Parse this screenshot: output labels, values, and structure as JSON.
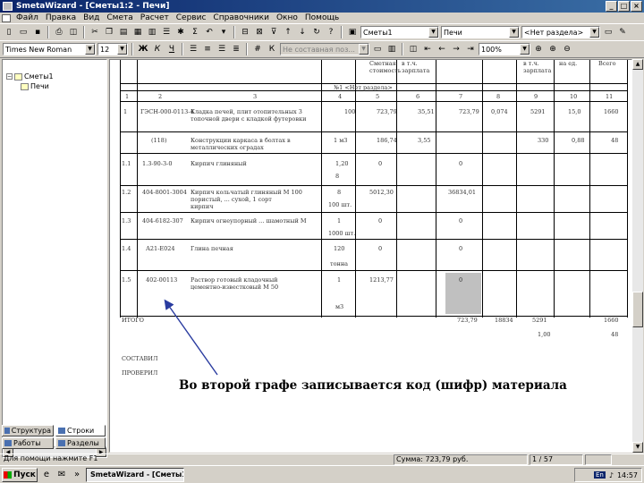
{
  "window": {
    "title": "SmetaWizard - [Сметы1:2 - Печи]"
  },
  "menu": [
    "Файл",
    "Правка",
    "Вид",
    "Смета",
    "Расчет",
    "Сервис",
    "Справочники",
    "Окно",
    "Помощь"
  ],
  "toolbar1": {
    "estimate_combo": "Сметы1",
    "section_combo": "Печи",
    "no_section_combo": "<Нет раздела>"
  },
  "toolbar2": {
    "font_combo": "Times New Roman",
    "size_combo": "12",
    "bold": "Ж",
    "italic": "К",
    "underline": "Ч",
    "disabled_combo": "Не составная поз...",
    "zoom_combo": "100%"
  },
  "tree": {
    "root": "Сметы1",
    "child": "Печи"
  },
  "left_tabs": {
    "structure": "Структура",
    "rows": "Строки",
    "works": "Работы",
    "sections": "Разделы"
  },
  "doc": {
    "col_headers_top": [
      "Сметная",
      "в т.ч.",
      "в т.ч.",
      "на ед.",
      "Всего"
    ],
    "col_headers_top2": [
      "стоимость",
      "зарплата",
      "зарплата"
    ],
    "section_label": "№1 <Нет раздела>",
    "col_numbers": [
      "1",
      "2",
      "3",
      "4",
      "5",
      "6",
      "7",
      "8",
      "9",
      "10",
      "11"
    ],
    "rows": [
      {
        "num": "1",
        "code": "ГЭСН-000-0113-4",
        "name1": "Кладка печей, плит отопительных 3",
        "name2": "топочной двери с кладкой футеровки",
        "unit": "100",
        "c5": "723,79",
        "c6": "35,51",
        "c7": "723,79",
        "c8": "0,074",
        "c9": "5291",
        "c10": "15,0",
        "c11": "1660"
      },
      {
        "num": "",
        "code": "(118)",
        "name1": "Конструкции каркаса в болтах в",
        "name2": "металлических оградах",
        "unit": "1 м3",
        "c5": "186,74",
        "c6": "3,55",
        "c7": "",
        "c8": "",
        "c9": "330",
        "c10": "0,88",
        "c11": "48"
      },
      {
        "num": "1.1",
        "code": "1.3-90-3-0",
        "name1": "Кирпич глиняный",
        "name2": "",
        "unit": "1,20",
        "c5": "0",
        "c6": "",
        "c7": "0",
        "c8": "",
        "c9": "",
        "c10": "",
        "c11": ""
      },
      {
        "num": "1.2",
        "code": "404-8001-3004",
        "name1": "Кирпич кольчатый глиняный М 100",
        "name2": "пористый, ... сухой, 1 сорт",
        "unit": "8",
        "c5": "5012,30",
        "c6": "",
        "c7": "36834,01",
        "c8": "",
        "c9": "",
        "c10": "",
        "c11": ""
      },
      {
        "num": "1.3",
        "code": "404-6182-307",
        "name1": "Кирпич огнеупорный ... шамотный М",
        "name2": "",
        "unit": "1",
        "c5": "0",
        "c6": "",
        "c7": "0",
        "c8": "",
        "c9": "",
        "c10": "",
        "c11": ""
      },
      {
        "num": "1.4",
        "code": "А21-Е024",
        "name1": "Глина печная",
        "name2": "",
        "unit": "120",
        "c5": "0",
        "c6": "",
        "c7": "0",
        "c8": "",
        "c9": "",
        "c10": "",
        "c11": ""
      },
      {
        "num": "1.5",
        "code": "402-00113",
        "name1": "Раствор готовый кладочный",
        "name2": "цементно-известковый М 50",
        "unit": "1",
        "c5": "1213,77",
        "c6": "",
        "c7": "0",
        "c8": "",
        "c9": "",
        "c10": "",
        "c11": ""
      }
    ],
    "unit_subs": {
      "r2b": "кирпич",
      "r3": "100 шт.",
      "r4": "1000 шт.",
      "r5": "тонна",
      "r6": "м3",
      "r1b": "8"
    },
    "total_label": "ИТОГО",
    "total_vals": {
      "c7": "723,79",
      "c8": "18834",
      "c9": "5291",
      "c11": "1660"
    },
    "total_sub": {
      "c9": "1,00",
      "c11": "48"
    },
    "composed": "СОСТАВИЛ",
    "checked": "ПРОВЕРИЛ"
  },
  "callout": "Во второй графе записывается код (шифр) материала",
  "statusbar": {
    "help": "Для помощи нажмите F1",
    "sum": "Сумма: 723,79 руб.",
    "page": "1 / 57"
  },
  "taskbar": {
    "start": "Пуск",
    "task": "SmetaWizard - [Сметы1...",
    "lang": "En",
    "clock": "14:57"
  }
}
